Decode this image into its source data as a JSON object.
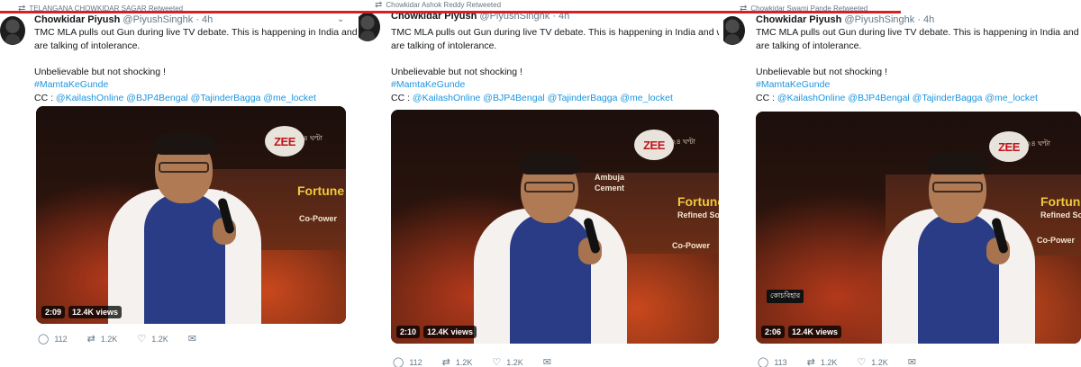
{
  "tweets": [
    {
      "retweeted_by": "TELANGANA CHOWKIDAR SAGAR Retweeted",
      "name": "Chowkidar Piyush",
      "handle": "@PiyushSinghk",
      "time": "· 4h",
      "line1": "TMC MLA pulls out Gun during live TV debate. This is happening in India and we",
      "line2": "are talking of intolerance.",
      "line3": "Unbelievable but not shocking !",
      "hashtag": "#MamtaKeGunde",
      "cc_prefix": "CC : ",
      "mentions": "@KailashOnline @BJP4Bengal @TajinderBagga @me_locket",
      "duration": "2:09",
      "views": "12.4K views",
      "replies": "112",
      "retweets": "1.2K",
      "likes": "1.2K"
    },
    {
      "retweeted_by": "Chowkidar Ashok Reddy Retweeted",
      "name": "Chowkidar Piyush",
      "handle": "@PiyushSinghk",
      "time": "· 4h",
      "line1": "TMC MLA pulls out Gun during live TV debate. This is happening in India and we",
      "line2": "are talking of intolerance.",
      "line3": "Unbelievable but not shocking !",
      "hashtag": "#MamtaKeGunde",
      "cc_prefix": "CC : ",
      "mentions": "@KailashOnline @BJP4Bengal @TajinderBagga @me_locket",
      "duration": "2:10",
      "views": "12.4K views",
      "replies": "112",
      "retweets": "1.2K",
      "likes": "1.2K"
    },
    {
      "retweeted_by": "Chowkidar Swami Pande Retweeted",
      "name": "Chowkidar Piyush",
      "handle": "@PiyushSinghk",
      "time": "· 4h",
      "line1": "TMC MLA pulls out Gun during live TV debate. This is happening in India and we",
      "line2": "are talking of intolerance.",
      "line3": "Unbelievable but not shocking !",
      "hashtag": "#MamtaKeGunde",
      "cc_prefix": "CC : ",
      "mentions": "@KailashOnline @BJP4Bengal @TajinderBagga @me_locket",
      "duration": "2:06",
      "views": "12.4K views",
      "replies": "113",
      "retweets": "1.2K",
      "likes": "1.2K"
    }
  ],
  "video_overlay": {
    "channel": "ZEE",
    "channel_sub": "২৪ ঘণ্টা",
    "sponsor1": "Fortune",
    "sponsor1_sub": "Refined Soyab",
    "sponsor2": "Ambuja",
    "sponsor2_sub": "Cement",
    "copower": "Co-Power",
    "lower_text": "কোচবিহার"
  },
  "icons": {
    "retweet": "retweet-icon",
    "reply": "reply-icon",
    "like": "heart-icon",
    "dm": "mail-icon",
    "caret": "chevron-down-icon"
  },
  "colors": {
    "link": "#1b95e0",
    "secondary_text": "#657786",
    "red_rule": "#d81f26"
  }
}
